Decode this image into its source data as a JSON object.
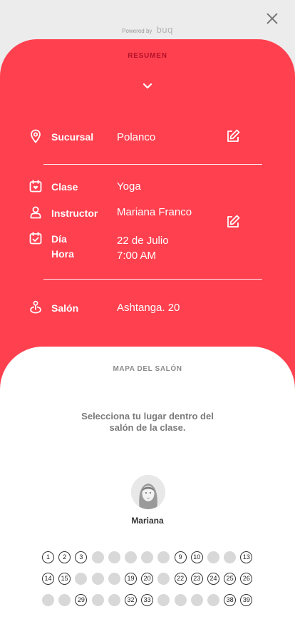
{
  "header": {
    "powered_by": "Powered by",
    "brand": "buq",
    "close_icon": "close-icon"
  },
  "summary": {
    "title": "RESUMEN",
    "rows": {
      "sucursal": {
        "label": "Sucursal",
        "value": "Polanco",
        "icon": "location-pin-icon"
      },
      "clase": {
        "label": "Clase",
        "value": "Yoga",
        "icon": "calendar-heart-icon"
      },
      "instructor": {
        "label": "Instructor",
        "value": "Mariana Franco",
        "icon": "person-icon"
      },
      "dia": {
        "label": "Día",
        "value": "22 de Julio",
        "icon": "calendar-check-icon"
      },
      "hora": {
        "label": "Hora",
        "value": "7:00 AM"
      },
      "salon": {
        "label": "Salón",
        "value": "Ashtanga. 20",
        "icon": "map-pin-person-icon"
      }
    },
    "colors": {
      "accent": "#ff404f",
      "title": "#b3132a"
    }
  },
  "map": {
    "title": "MAPA DEL SALÓN",
    "hint": "Selecciona tu lugar dentro del salón de la clase.",
    "instructor_name": "Mariana",
    "seat_rows": [
      [
        "1",
        "2",
        "3",
        "",
        "",
        "",
        "",
        "",
        "9",
        "10",
        "",
        "",
        "13"
      ],
      [
        "14",
        "15",
        "",
        "",
        "",
        "19",
        "20",
        "",
        "22",
        "23",
        "24",
        "25",
        "26"
      ],
      [
        "",
        "",
        "29",
        "",
        "",
        "32",
        "33",
        "",
        "",
        "",
        "",
        "38",
        "39"
      ]
    ]
  }
}
